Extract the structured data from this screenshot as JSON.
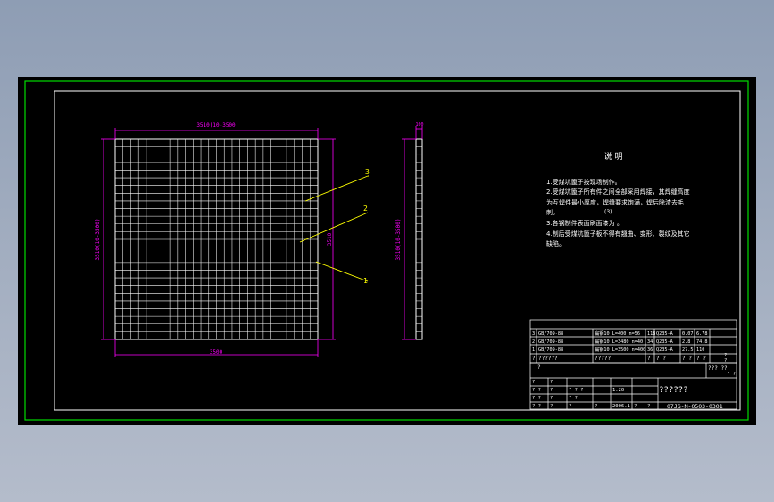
{
  "drawing": {
    "top_width_dim": "3510(10-3500",
    "bottom_width_dim": "3500",
    "left_height_dim": "3510(10-3500)",
    "right_height_dim": "3510",
    "side_top_dim": "100",
    "side_height_dim": "3510(10-3500)",
    "callouts": [
      "3",
      "2",
      "1"
    ]
  },
  "notes": {
    "title": "说      明",
    "lines": [
      "1.受煤坑篦子按现场制作。",
      "2.受煤坑篦子所有件之间全部采用焊接，其焊缝高度",
      "为互焊件最小厚度，焊缝要求饱满，焊后除渣去毛",
      "刺。",
      "3.各钢制件表面刷面漆为   。",
      "4.制后受煤坑篦子板不得有翘曲、变形、裂纹及其它",
      "缺陷。"
    ],
    "line_3_extra": "(3)"
  },
  "bom": {
    "rows": [
      [
        "3",
        "GB/709-88",
        "扁钢10 L=400 n=56",
        "118",
        "Q235-A",
        "0.07",
        "6.78"
      ],
      [
        "2",
        "GB/709-88",
        "扁钢10 L=3480 n=40",
        "34",
        "Q235-A",
        "2.8",
        "74.8"
      ],
      [
        "1",
        "GB/709-88",
        "扁钢10 L=3500 n=400",
        "36",
        "Q235-A",
        "27.5",
        "110"
      ]
    ],
    "header": [
      "?",
      "??????",
      "?????",
      "?",
      "? ?",
      "? ?",
      "? ?"
    ],
    "header_extra": [
      "?",
      "?"
    ]
  },
  "title_block": {
    "small_mark": "?",
    "scale_label": "??? ??",
    "scale_sub": "? ?",
    "left_rows": [
      [
        "?",
        "?",
        "",
        "",
        ""
      ],
      [
        "? ?",
        "?",
        "? ? ?",
        "",
        "1:20"
      ],
      [
        "? ?",
        "?",
        "? ?",
        "",
        ""
      ],
      [
        "? ?",
        "?",
        "?",
        "?",
        "2006.1"
      ]
    ],
    "name": "??????",
    "drawing_no": "07JG-M-0503-0301",
    "bottom_extra": [
      "?",
      "?"
    ]
  }
}
